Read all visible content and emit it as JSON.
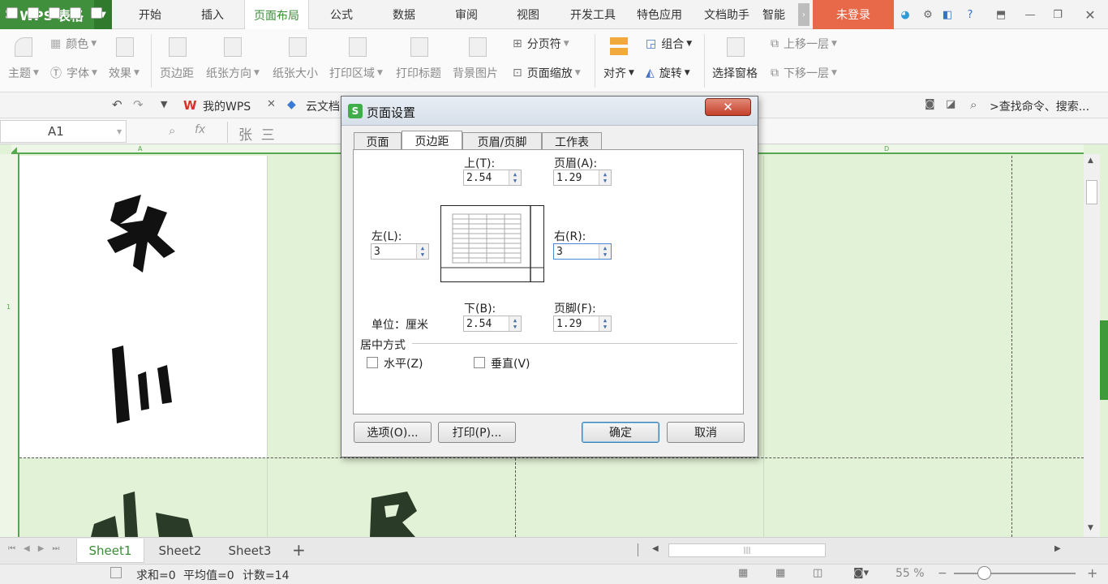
{
  "app": {
    "title": "WPS 表格",
    "logo": "S"
  },
  "menu_tabs": [
    "开始",
    "插入",
    "页面布局",
    "公式",
    "数据",
    "审阅",
    "视图",
    "开发工具",
    "特色应用",
    "文档助手",
    "智能"
  ],
  "active_tab": "页面布局",
  "login_label": "未登录",
  "ribbon": {
    "theme": "主题",
    "colors": "颜色",
    "fonts": "字体",
    "effects": "效果",
    "margins": "页边距",
    "orientation": "纸张方向",
    "size": "纸张大小",
    "print_area": "打印区域",
    "print_titles": "打印标题",
    "background": "背景图片",
    "page_break": "分页符",
    "scale": "页面缩放",
    "align": "对齐",
    "group": "组合",
    "rotate": "旋转",
    "selection_pane": "选择窗格",
    "bring_forward": "上移一层",
    "send_backward": "下移一层"
  },
  "quickbar": {
    "tab1": "我的WPS",
    "tab2": "云文档",
    "search": ">查找命令、搜索..."
  },
  "formula_bar": {
    "cell": "A1",
    "fx": "fx",
    "content": "张  三"
  },
  "columns": {
    "a": "A",
    "d": "D"
  },
  "rows": {
    "r1": "1"
  },
  "dialog": {
    "title": "页面设置",
    "tabs": [
      "页面",
      "页边距",
      "页眉/页脚",
      "工作表"
    ],
    "active_tab": "页边距",
    "top": {
      "label": "上(T):",
      "value": "2.54"
    },
    "header": {
      "label": "页眉(A):",
      "value": "1.29"
    },
    "left": {
      "label": "左(L):",
      "value": "3"
    },
    "right": {
      "label": "右(R):",
      "value": "3"
    },
    "bottom": {
      "label": "下(B):",
      "value": "2.54"
    },
    "footer": {
      "label": "页脚(F):",
      "value": "1.29"
    },
    "unit": "单位：厘米",
    "center_section": "居中方式",
    "horizontal": "水平(Z)",
    "vertical": "垂直(V)",
    "options_btn": "选项(O)...",
    "print_btn": "打印(P)...",
    "ok_btn": "确定",
    "cancel_btn": "取消"
  },
  "sheet_tabs": [
    "Sheet1",
    "Sheet2",
    "Sheet3"
  ],
  "active_sheet": "Sheet1",
  "status": {
    "sum": "求和=0",
    "avg": "平均值=0",
    "count": "计数=14",
    "zoom": "55 %"
  }
}
